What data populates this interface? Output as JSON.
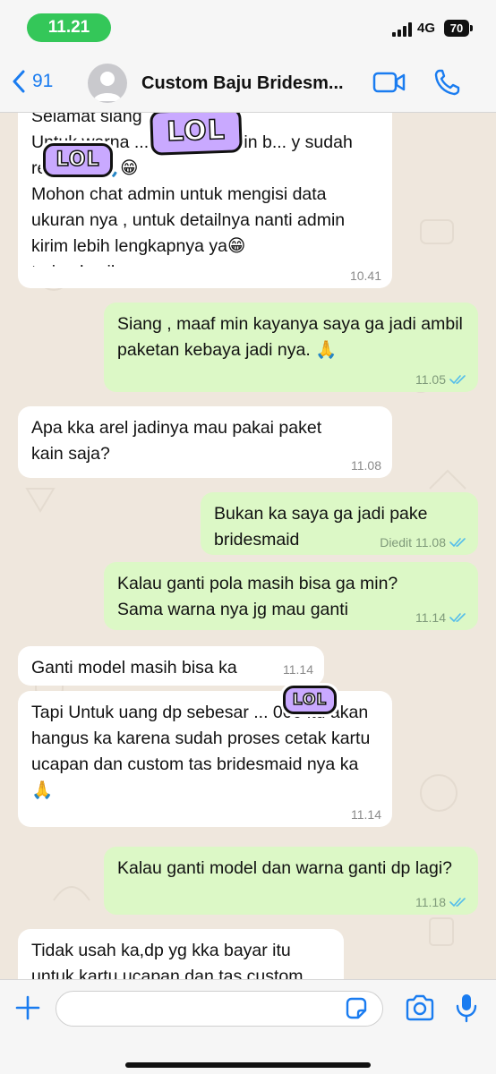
{
  "status_bar": {
    "time": "11.21",
    "network": "4G",
    "battery": "70"
  },
  "header": {
    "back_count": "91",
    "contact_name": "Custom Baju Bridesm..."
  },
  "messages": [
    {
      "direction": "in",
      "text": "Selamat siang\nUntuk warna ... el bahan kain b... y sudah ready ya🙏😁\nMohon chat admin untuk mengisi data ukuran nya , untuk detailnya nanti admin kirim lebih lengkapnya ya😁\nterimakasih",
      "time": "10.41"
    },
    {
      "direction": "out",
      "text": "Siang , maaf min kayanya saya ga jadi ambil paketan kebaya jadi nya. 🙏",
      "time": "11.05"
    },
    {
      "direction": "in",
      "text": "Apa kka arel jadinya mau pakai paket kain saja?",
      "time": "11.08"
    },
    {
      "direction": "out",
      "text": "Bukan ka saya ga jadi pake bridesmaid",
      "time": "11.08",
      "edited": "Diedit"
    },
    {
      "direction": "out",
      "text": "Kalau ganti pola masih bisa ga min? Sama warna nya jg mau ganti",
      "time": "11.14"
    },
    {
      "direction": "in",
      "text": "Ganti model masih bisa ka",
      "time": "11.14"
    },
    {
      "direction": "in",
      "text": "Tapi Untuk uang dp sebesar ... 000 itu akan hangus ka karena sudah proses cetak kartu ucapan dan custom tas bridesmaid nya ka🙏",
      "time": "11.14"
    },
    {
      "direction": "out",
      "text": "Kalau ganti model dan warna ganti dp lagi?",
      "time": "11.18"
    },
    {
      "direction": "in",
      "text": "Tidak usah ka,dp yg kka bayar itu untuk kartu ucapan dan tas custom"
    }
  ],
  "stickers": [
    "LOL",
    "LOL",
    "LOL"
  ],
  "input": {
    "placeholder": ""
  },
  "colors": {
    "incoming": "#ffffff",
    "outgoing": "#dcf8c6",
    "accent": "#1a7cf0",
    "time_pill": "#34c759",
    "sticker": "#c9a9ff"
  },
  "icons": [
    "signal-icon",
    "chevron-left-icon",
    "avatar-icon",
    "video-call-icon",
    "phone-icon",
    "plus-icon",
    "sticker-icon",
    "camera-icon",
    "microphone-icon",
    "double-check-icon"
  ]
}
